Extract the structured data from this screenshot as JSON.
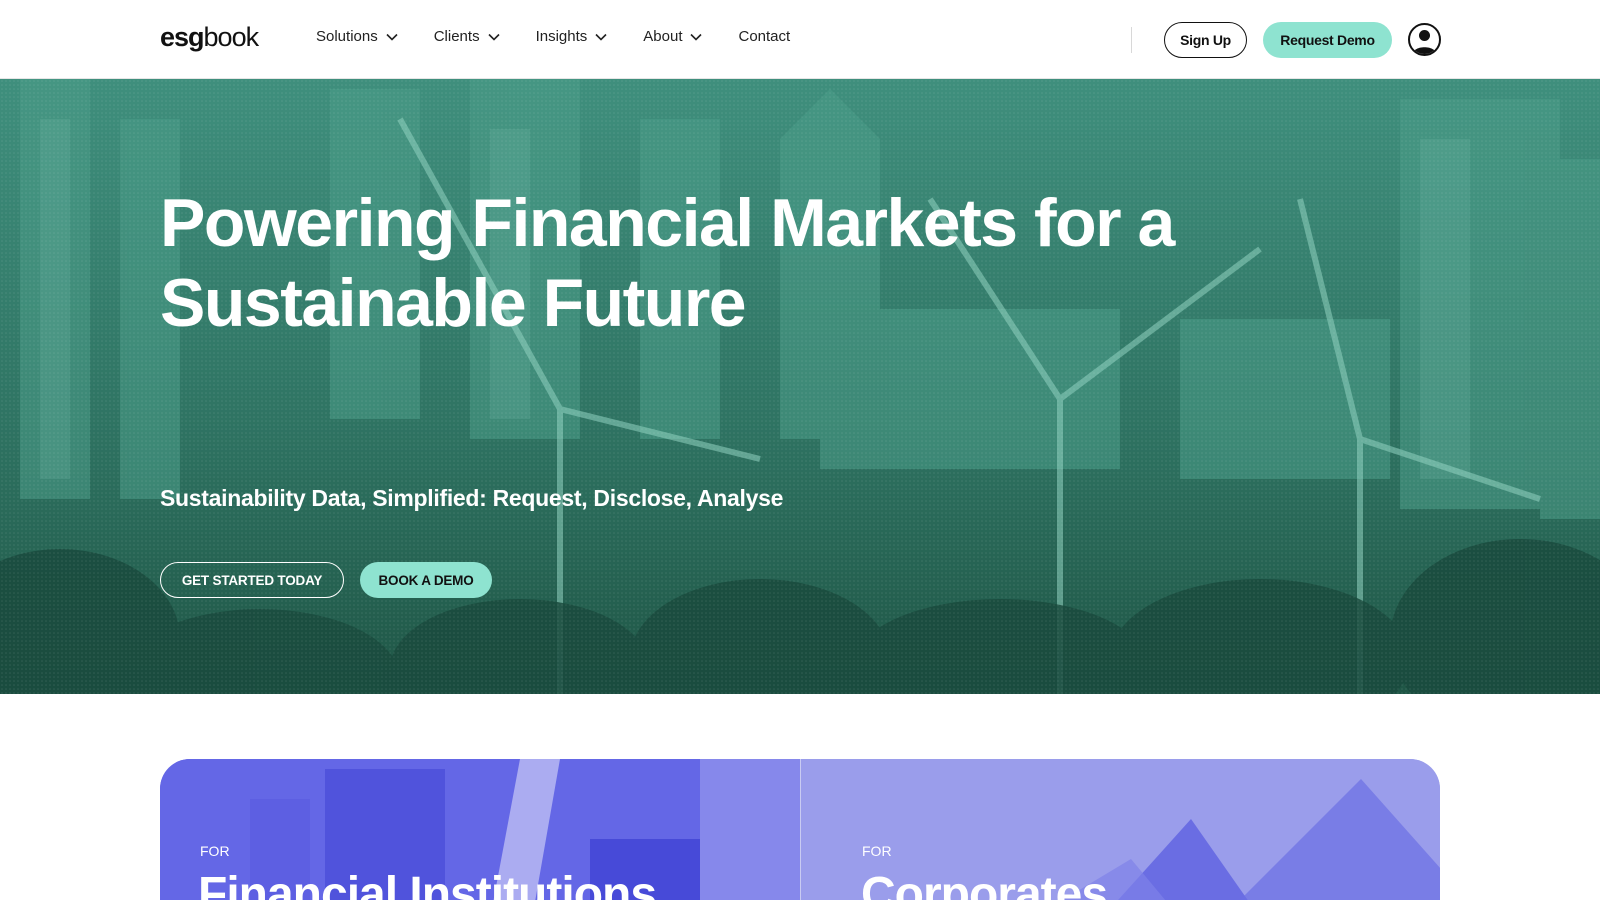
{
  "header": {
    "logo": {
      "bold": "esg",
      "light": "book"
    },
    "nav": [
      {
        "label": "Solutions",
        "has_dropdown": true
      },
      {
        "label": "Clients",
        "has_dropdown": true
      },
      {
        "label": "Insights",
        "has_dropdown": true
      },
      {
        "label": "About",
        "has_dropdown": true
      },
      {
        "label": "Contact",
        "has_dropdown": false
      }
    ],
    "signup_label": "Sign Up",
    "request_demo_label": "Request Demo",
    "account_icon": "user-account-icon"
  },
  "hero": {
    "title_line1": "Powering Financial Markets for a",
    "title_line2": "Sustainable Future",
    "subtitle": "Sustainability Data, Simplified: Request, Disclose, Analyse",
    "cta_primary": "GET STARTED TODAY",
    "cta_secondary": "BOOK A DEMO"
  },
  "cards": [
    {
      "eyebrow": "FOR",
      "title": "Financial Institutions"
    },
    {
      "eyebrow": "FOR",
      "title": "Corporates"
    }
  ],
  "colors": {
    "accent": "#8ee3d0",
    "hero_green": "#2d6d5e",
    "card_blue": "#6c6ee8",
    "card_lavender": "#9b9eea",
    "text_dark": "#111111"
  }
}
